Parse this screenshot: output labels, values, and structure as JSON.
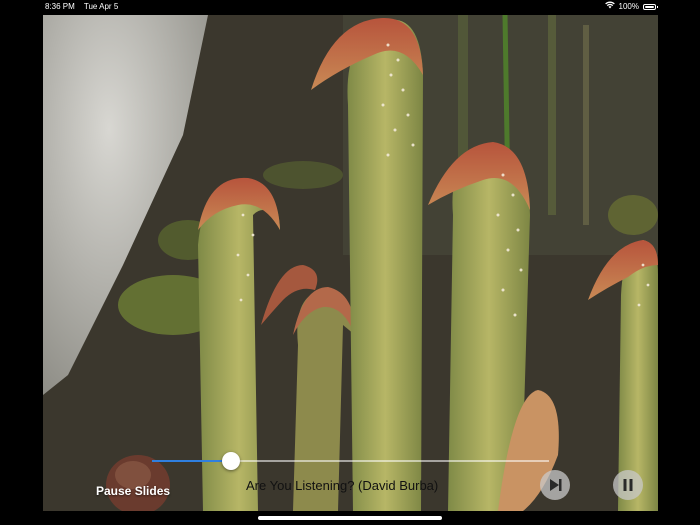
{
  "status_bar": {
    "time": "8:36 PM",
    "date": "Tue Apr 5",
    "battery": "100%",
    "wifi_icon": "wifi-icon",
    "battery_icon": "battery-icon"
  },
  "slideshow": {
    "photo_subject": "pitcher plants",
    "pause_label": "Pause Slides",
    "song_title": "Are You Listening? (David Burba)",
    "progress": 0.2,
    "accent_color": "#2f7fe0",
    "next_icon": "skip-next-icon",
    "pause_icon": "pause-icon"
  }
}
